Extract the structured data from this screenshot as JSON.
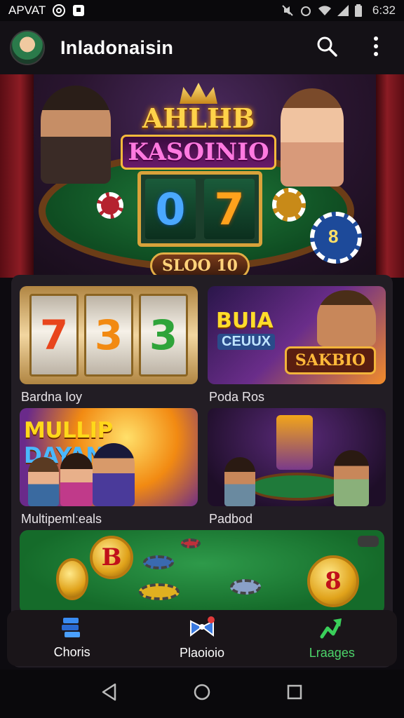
{
  "status_bar": {
    "carrier": "APVAT",
    "time": "6:32",
    "icons": [
      "at-icon",
      "notification-box-icon",
      "mute-icon",
      "alarm-icon",
      "wifi-icon",
      "signal-icon",
      "battery-icon"
    ]
  },
  "app_bar": {
    "title": "Inladonaisin",
    "icons": [
      "avatar",
      "search-icon",
      "more-vert-icon"
    ]
  },
  "hero": {
    "logo_top": "AHLHB",
    "logo_bottom": "KASOINIO",
    "reel_digits": [
      "0",
      "7"
    ],
    "badge": "SLOO 10",
    "chip_label": "8"
  },
  "games": [
    {
      "label": "Bardna Ioy",
      "reels": [
        "7",
        "3",
        "3"
      ]
    },
    {
      "label": "Poda Ros",
      "title1": "BUIA",
      "title2": "CEUUX",
      "badge": "SAKBIO"
    },
    {
      "label": "Multipeml:eals",
      "title_a": "MULLIP",
      "title_b": "DAYAN"
    },
    {
      "label": "Padbod"
    }
  ],
  "banner": {
    "coin_left": "B",
    "coin_right": "8"
  },
  "bottom_nav": [
    {
      "label": "Choris",
      "icon": "stack-icon",
      "active": false
    },
    {
      "label": "Plaoioio",
      "icon": "bowtie-icon",
      "active": false
    },
    {
      "label": "Lraages",
      "icon": "share-arrow-icon",
      "active": true
    }
  ],
  "colors": {
    "accent_active": "#4cd46a",
    "app_bar_bg": "#141116",
    "card_bg": "#221d24"
  }
}
